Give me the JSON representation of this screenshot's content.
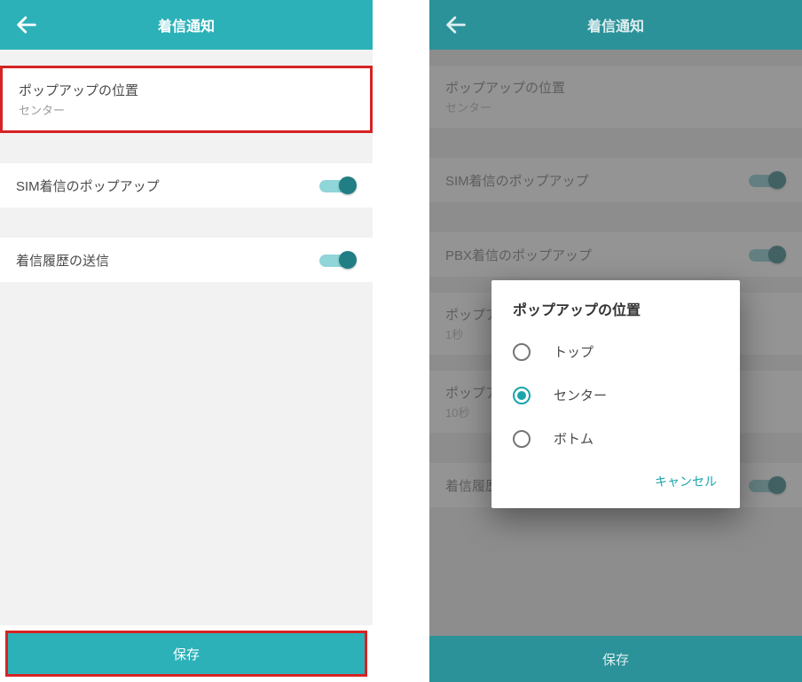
{
  "left": {
    "header": {
      "title": "着信通知"
    },
    "popup_position": {
      "label": "ポップアップの位置",
      "value": "センター"
    },
    "sim_popup": {
      "label": "SIM着信のポップアップ",
      "on": true
    },
    "send_history": {
      "label": "着信履歴の送信",
      "on": true
    },
    "save_label": "保存"
  },
  "right": {
    "header": {
      "title": "着信通知"
    },
    "popup_position": {
      "label": "ポップアップの位置",
      "value": "センター"
    },
    "sim_popup": {
      "label": "SIM着信のポップアップ",
      "on": true
    },
    "pbx_popup": {
      "label": "PBX着信のポップアップ",
      "on": true
    },
    "popup_time1": {
      "label": "ポップアップ表示時間",
      "value": "1秒"
    },
    "popup_time2": {
      "label": "ポップアップ表示時間",
      "value": "10秒"
    },
    "send_history": {
      "label": "着信履歴の送信",
      "on": true
    },
    "save_label": "保存",
    "dialog": {
      "title": "ポップアップの位置",
      "options": [
        {
          "label": "トップ",
          "selected": false
        },
        {
          "label": "センター",
          "selected": true
        },
        {
          "label": "ボトム",
          "selected": false
        }
      ],
      "cancel": "キャンセル"
    }
  }
}
